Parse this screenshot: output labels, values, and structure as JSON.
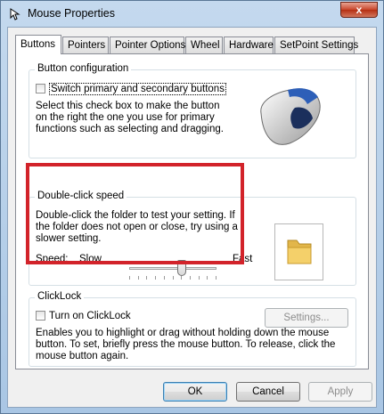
{
  "window": {
    "title": "Mouse Properties",
    "close_label": "x"
  },
  "tabs": [
    {
      "label": "Buttons",
      "active": true
    },
    {
      "label": "Pointers",
      "active": false
    },
    {
      "label": "Pointer Options",
      "active": false
    },
    {
      "label": "Wheel",
      "active": false
    },
    {
      "label": "Hardware",
      "active": false
    },
    {
      "label": "SetPoint Settings",
      "active": false
    }
  ],
  "button_config": {
    "title": "Button configuration",
    "checkbox_label": "Switch primary and secondary buttons",
    "checked": false,
    "description": "Select this check box to make the button on the right the one you use for primary functions such as selecting and dragging."
  },
  "double_click": {
    "title": "Double-click speed",
    "description": "Double-click the folder to test your setting. If the folder does not open or close, try using a slower setting.",
    "speed_label": "Speed:",
    "slow_label": "Slow",
    "fast_label": "Fast",
    "slider_value": 0.6
  },
  "clicklock": {
    "title": "ClickLock",
    "checkbox_label": "Turn on ClickLock",
    "checked": false,
    "settings_label": "Settings...",
    "description": "Enables you to highlight or drag without holding down the mouse button. To set, briefly press the mouse button. To release, click the mouse button again."
  },
  "footer": {
    "ok_label": "OK",
    "cancel_label": "Cancel",
    "apply_label": "Apply"
  },
  "colors": {
    "highlight": "#d2232a",
    "accent_blue": "#2d5fb8"
  }
}
